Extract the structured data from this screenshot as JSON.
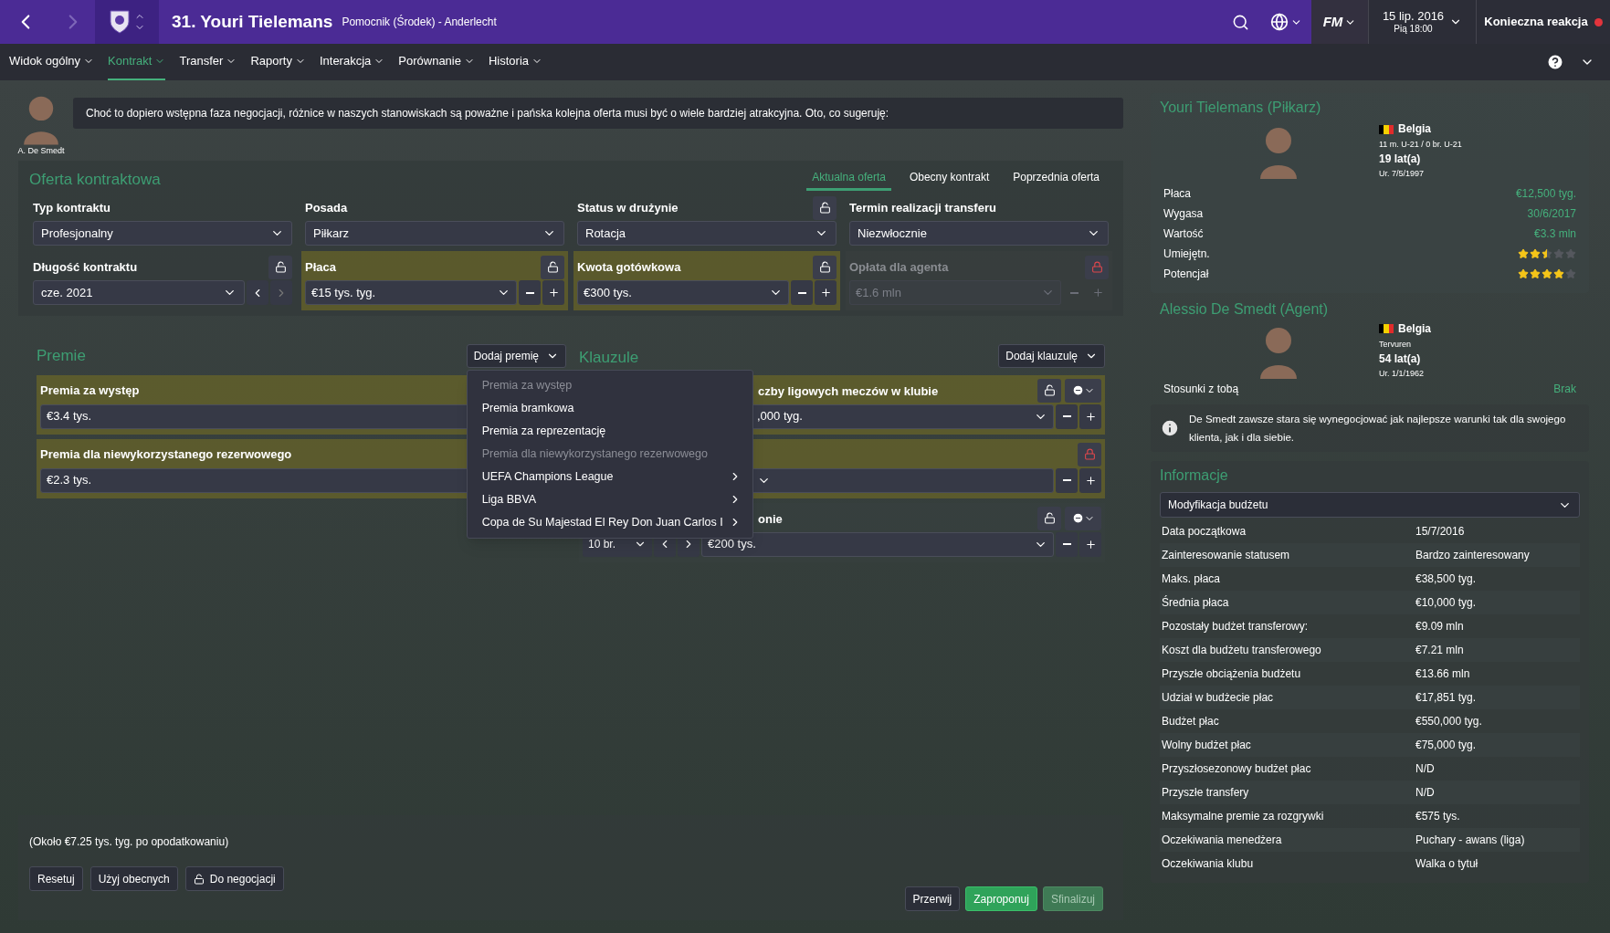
{
  "header": {
    "title": "31. Youri Tielemans",
    "subtitle": "Pomocnik (Środek) - Anderlecht",
    "logo": "FM",
    "date": "15 lip. 2016",
    "time": "Pią 18:00",
    "alert": "Konieczna reakcja"
  },
  "menu": [
    {
      "label": "Widok ogólny",
      "selected": false
    },
    {
      "label": "Kontrakt",
      "selected": true
    },
    {
      "label": "Transfer",
      "selected": false
    },
    {
      "label": "Raporty",
      "selected": false
    },
    {
      "label": "Interakcja",
      "selected": false
    },
    {
      "label": "Porównanie",
      "selected": false
    },
    {
      "label": "Historia",
      "selected": false
    }
  ],
  "agent_message": {
    "name": "A. De Smedt",
    "text": "Choć to dopiero wstępna faza negocjacji, różnice w naszych stanowiskach są poważne i pańska kolejna oferta musi być o wiele bardziej atrakcyjna. Oto, co sugeruję:"
  },
  "offer": {
    "title": "Oferta kontraktowa",
    "tabs": [
      {
        "label": "Aktualna oferta",
        "selected": true
      },
      {
        "label": "Obecny kontrakt",
        "selected": false
      },
      {
        "label": "Poprzednia oferta",
        "selected": false
      }
    ],
    "fields": [
      {
        "label": "Typ kontraktu",
        "value": "Profesjonalny",
        "kind": "select",
        "highlighted": false,
        "disabled": false
      },
      {
        "label": "Posada",
        "value": "Piłkarz",
        "kind": "select",
        "highlighted": false,
        "disabled": false
      },
      {
        "label": "Status w drużynie",
        "value": "Rotacja",
        "kind": "select",
        "locked": false,
        "highlighted": false,
        "disabled": false
      },
      {
        "label": "Termin realizacji transferu",
        "value": "Niezwłocznie",
        "kind": "select",
        "highlighted": false,
        "disabled": false
      },
      {
        "label": "Długość kontraktu",
        "value": "cze. 2021",
        "kind": "date",
        "locked": false,
        "highlighted": false,
        "disabled": false
      },
      {
        "label": "Płaca",
        "value": "€15 tys. tyg.",
        "kind": "amount",
        "locked": false,
        "highlighted": true,
        "disabled": false
      },
      {
        "label": "Kwota gotówkowa",
        "value": "€300 tys.",
        "kind": "amount",
        "locked": false,
        "highlighted": true,
        "disabled": false
      },
      {
        "label": "Opłata dla agenta",
        "value": "€1.6 mln",
        "kind": "amount",
        "locked": true,
        "highlighted": false,
        "disabled": true
      }
    ]
  },
  "bonuses": {
    "title": "Premie",
    "add_button": "Dodaj premię",
    "items": [
      {
        "label": "Premia za występ",
        "value": "€3.4 tys."
      },
      {
        "label": "Premia dla niewykorzystanego rezerwowego",
        "value": "€2.3 tys."
      }
    ],
    "menu": [
      {
        "label": "Premia za występ",
        "disabled": true,
        "submenu": false
      },
      {
        "label": "Premia bramkowa",
        "disabled": false,
        "submenu": false
      },
      {
        "label": "Premia za reprezentację",
        "disabled": false,
        "submenu": false
      },
      {
        "label": "Premia dla niewykorzystanego rezerwowego",
        "disabled": true,
        "submenu": false
      },
      {
        "label": "UEFA Champions League",
        "disabled": false,
        "submenu": true
      },
      {
        "label": "Liga BBVA",
        "disabled": false,
        "submenu": true
      },
      {
        "label": "Copa de Su Majestad El Rey Don Juan Carlos I",
        "disabled": false,
        "submenu": true
      }
    ]
  },
  "clauses": {
    "title": "Klauzule",
    "add_button": "Dodaj klauzulę",
    "items": [
      {
        "label": "czby ligowych meczów w klubie",
        "value": ",000 tyg.",
        "locked": false,
        "highlighted": true
      },
      {
        "locked": true,
        "highlighted": true
      },
      {
        "label": "onie",
        "count": "10 br.",
        "value": "€200 tys.",
        "locked": false,
        "highlighted": false
      }
    ]
  },
  "net_note": "(Około €7.25 tys. tyg. po opodatkowaniu)",
  "left_buttons": [
    {
      "label": "Resetuj",
      "kind": "plain"
    },
    {
      "label": "Użyj obecnych",
      "kind": "plain"
    },
    {
      "label": "Do negocjacji",
      "kind": "lock"
    }
  ],
  "right_buttons": [
    {
      "label": "Przerwij",
      "kind": "default",
      "disabled": false
    },
    {
      "label": "Zaproponuj",
      "kind": "primary",
      "disabled": false
    },
    {
      "label": "Sfinalizuj",
      "kind": "primary",
      "disabled": true
    }
  ],
  "player": {
    "title": "Youri Tielemans (Piłkarz)",
    "nationality": "Belgia",
    "caps": "11 m. U-21 / 0 br. U-21",
    "age": "19 lat(a)",
    "born": "Ur. 7/5/1997",
    "stats": [
      {
        "label": "Płaca",
        "value": "€12,500 tyg."
      },
      {
        "label": "Wygasa",
        "value": "30/6/2017"
      },
      {
        "label": "Wartość",
        "value": "€3.3 mln"
      }
    ],
    "ratings": [
      {
        "label": "Umiejętn.",
        "stars": 2.5
      },
      {
        "label": "Potencjał",
        "stars": 4
      }
    ]
  },
  "agent": {
    "title": "Alessio De Smedt (Agent)",
    "nationality": "Belgia",
    "city": "Tervuren",
    "age": "54 lat(a)",
    "born": "Ur. 1/1/1962",
    "relation_label": "Stosunki z tobą",
    "relation_value": "Brak",
    "note": "De Smedt zawsze stara się wynegocjować jak najlepsze warunki tak dla swojego klienta, jak i dla siebie."
  },
  "info": {
    "title": "Informacje",
    "select": "Modyfikacja budżetu",
    "rows": [
      {
        "label": "Data początkowa",
        "value": "15/7/2016"
      },
      {
        "label": "Zainteresowanie statusem",
        "value": "Bardzo zainteresowany"
      },
      {
        "label": "Maks. płaca",
        "value": "€38,500 tyg."
      },
      {
        "label": "Średnia płaca",
        "value": "€10,000 tyg."
      },
      {
        "label": "Pozostały budżet transferowy:",
        "value": "€9.09 mln"
      },
      {
        "label": "Koszt dla budżetu transferowego",
        "value": "€7.21 mln"
      },
      {
        "label": "Przyszłe obciążenia budżetu",
        "value": "€13.66 mln"
      },
      {
        "label": "Udział w budżecie płac",
        "value": "€17,851 tyg."
      },
      {
        "label": "Budżet płac",
        "value": "€550,000 tyg."
      },
      {
        "label": "Wolny budżet płac",
        "value": "€75,000 tyg."
      },
      {
        "label": "Przyszłosezonowy budżet płac",
        "value": "N/D"
      },
      {
        "label": "Przyszłe transfery",
        "value": "N/D"
      },
      {
        "label": "Maksymalne premie za rozgrywki",
        "value": "€575 tys."
      },
      {
        "label": "Oczekiwania menedżera",
        "value": "Puchary - awans (liga)"
      },
      {
        "label": "Oczekiwania klubu",
        "value": "Walka o tytuł"
      }
    ]
  }
}
